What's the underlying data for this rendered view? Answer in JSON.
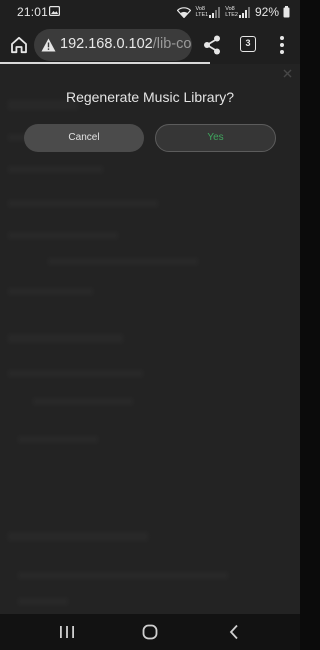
{
  "status_bar": {
    "time": "21:01",
    "sim1_label_top": "Vo8",
    "sim1_label_bottom": "LTE1",
    "sim2_label_top": "Vo8",
    "sim2_label_bottom": "LTE2",
    "battery": "92%",
    "icons": [
      "gallery-icon",
      "wifi-icon",
      "signal-icon",
      "battery-icon"
    ]
  },
  "browser": {
    "url_host": "192.168.0.102",
    "url_path": "/lib-confi",
    "tab_count": "3",
    "page_load_progress": 0.7,
    "icons": [
      "home-icon",
      "warning-icon",
      "share-icon",
      "tabs-icon",
      "more-vert-icon"
    ]
  },
  "dialog": {
    "title": "Regenerate Music Library?",
    "cancel_label": "Cancel",
    "confirm_label": "Yes"
  },
  "colors": {
    "confirm_text": "#3fa55d",
    "background": "#262626"
  },
  "nav": {
    "icons": [
      "recents-icon",
      "home-circle-icon",
      "back-icon"
    ]
  }
}
